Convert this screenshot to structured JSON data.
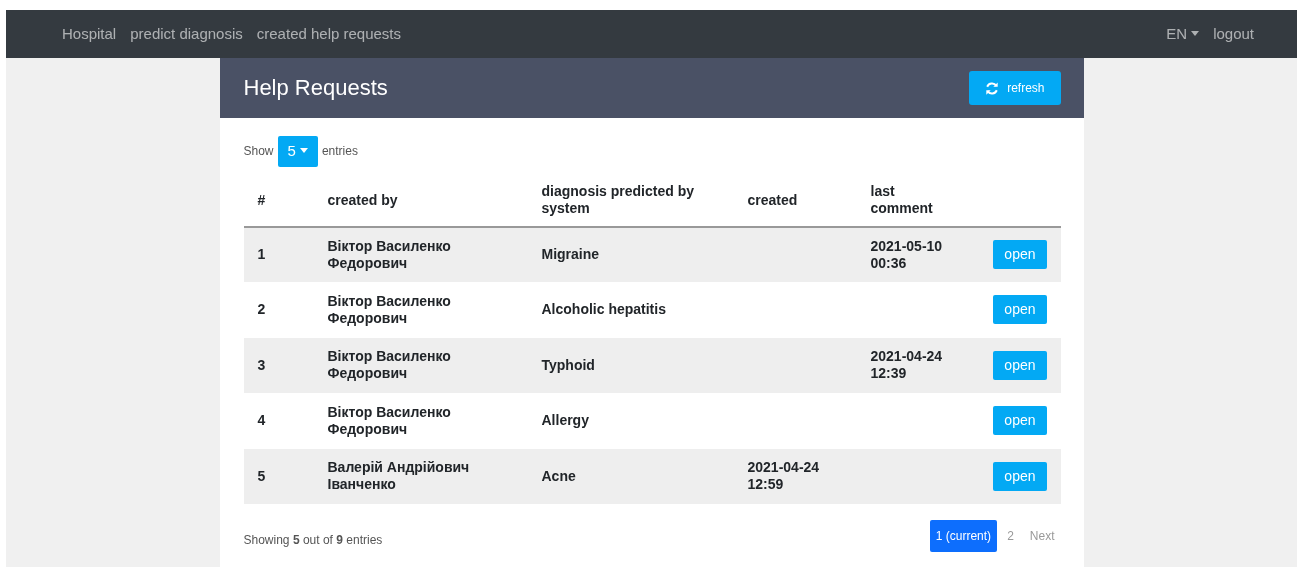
{
  "navbar": {
    "brand": "Hospital",
    "links": [
      "predict diagnosis",
      "created help requests"
    ],
    "language": "EN",
    "logout": "logout"
  },
  "panel": {
    "title": "Help Requests",
    "refresh": "refresh"
  },
  "length_menu": {
    "show": "Show",
    "value": "5",
    "entries": "entries"
  },
  "table": {
    "columns": [
      "#",
      "created by",
      "diagnosis predicted by system",
      "created",
      "last comment"
    ],
    "rows": [
      {
        "cells": [
          "1",
          "Віктор Василенко Федорович",
          "Migraine",
          "",
          "2021-05-10 00:36"
        ],
        "action": "open"
      },
      {
        "cells": [
          "2",
          "Віктор Василенко Федорович",
          "Alcoholic hepatitis",
          "",
          ""
        ],
        "action": "open"
      },
      {
        "cells": [
          "3",
          "Віктор Василенко Федорович",
          "Typhoid",
          "",
          "2021-04-24 12:39"
        ],
        "action": "open"
      },
      {
        "cells": [
          "4",
          "Віктор Василенко Федорович",
          "Allergy",
          "",
          ""
        ],
        "action": "open"
      },
      {
        "cells": [
          "5",
          "Валерій Андрійович Іванченко",
          "Acne",
          "2021-04-24 12:59",
          ""
        ],
        "action": "open"
      }
    ]
  },
  "info": "Showing **5** out of **9** entries",
  "pagination": {
    "pages": [
      {
        "label": "1 (current)",
        "selected": true
      },
      {
        "label": "2",
        "selected": false
      }
    ],
    "next": "Next"
  }
}
